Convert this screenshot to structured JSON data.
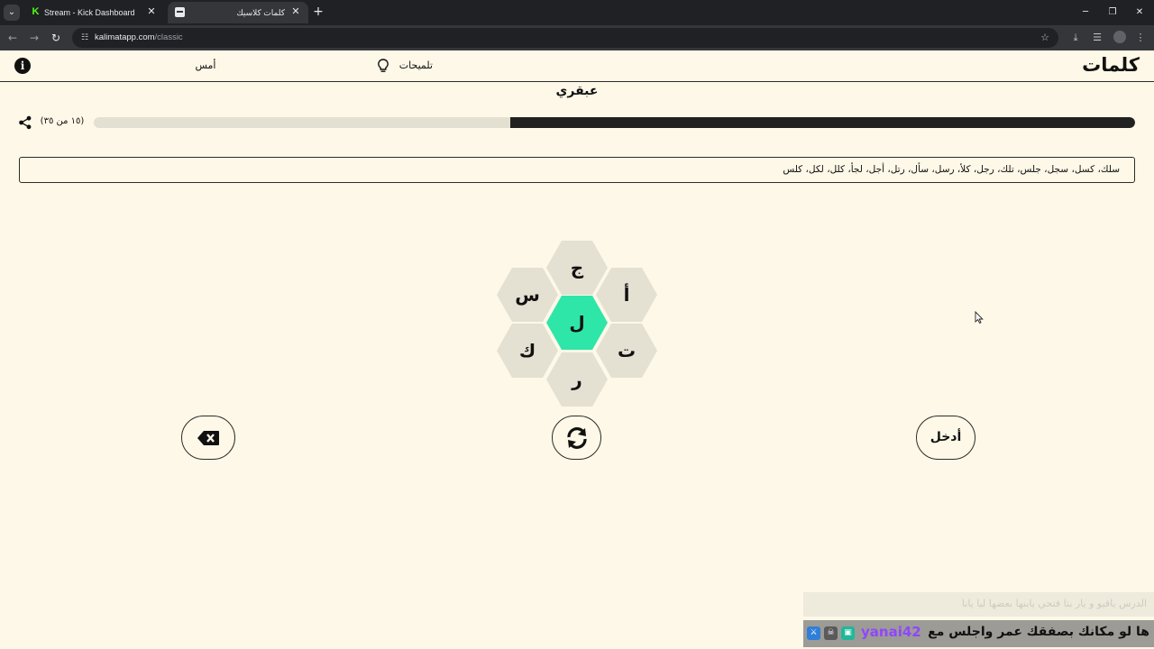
{
  "browser": {
    "tabs": [
      {
        "title": "Stream - Kick Dashboard",
        "favicon": "kick-logo-icon",
        "active": false
      },
      {
        "title": "كلمات كلاسيك",
        "favicon": "page-icon",
        "active": true
      }
    ],
    "url_domain": "kalimatapp.com",
    "url_path": "/classic"
  },
  "app": {
    "logo": "كلمات",
    "hints_label": "تلميحات",
    "yesterday_label": "أمس",
    "rank": "عبقري",
    "score_text": "(١٥ من ٣٥)",
    "progress": 0.6,
    "found_words": "سلك، كسل، سجل، جلس، تلك، رجل، كلأ، رسل، سأل، رتل، أجل، لجأ، كلل، لكل، كلس"
  },
  "hive": {
    "center": "ل",
    "outer": {
      "top": "ج",
      "upper_left": "س",
      "upper_right": "أ",
      "lower_left": "ك",
      "lower_right": "ت",
      "bottom": "ر"
    },
    "center_color": "#2ee6a8",
    "outer_color": "#e4e0d2"
  },
  "actions": {
    "enter_label": "أدخل",
    "shuffle_icon": "shuffle-icon",
    "delete_icon": "backspace-icon"
  },
  "stream_overlay": {
    "username": "yanai42",
    "message": "ها لو مكانك بصفقك عمر واجلس مع جدتي :",
    "faded_message": "الدرس يافيو و يار بتا فتحي يابنها بعضها ليا يانا"
  }
}
